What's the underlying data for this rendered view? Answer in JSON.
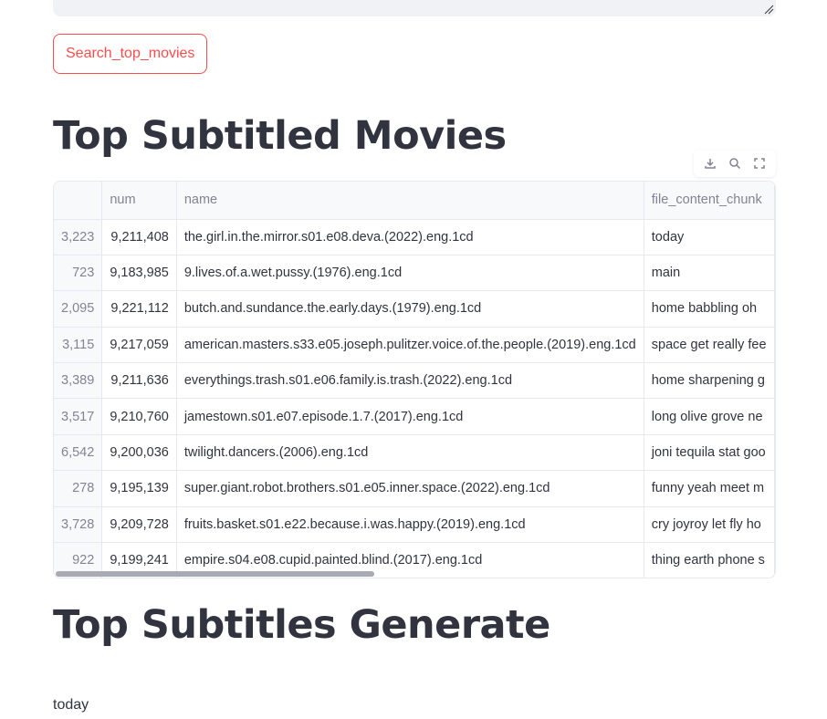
{
  "search_button": {
    "label": "Search_top_movies"
  },
  "sections": {
    "top_movies_title": "Top Subtitled Movies",
    "generate_title": "Top Subtitles Generate",
    "generate_output": "today"
  },
  "toolbar": {
    "icons": [
      "download-icon",
      "search-icon",
      "fullscreen-icon"
    ]
  },
  "table": {
    "columns": [
      "",
      "num",
      "name",
      "file_content_chunk"
    ],
    "rows": [
      {
        "index": "3,223",
        "num": "9,211,408",
        "name": "the.girl.in.the.mirror.s01.e08.deva.(2022).eng.1cd",
        "chunk": "today"
      },
      {
        "index": "723",
        "num": "9,183,985",
        "name": "9.lives.of.a.wet.pussy.(1976).eng.1cd",
        "chunk": "main"
      },
      {
        "index": "2,095",
        "num": "9,221,112",
        "name": "butch.and.sundance.the.early.days.(1979).eng.1cd",
        "chunk": "home babbling oh"
      },
      {
        "index": "3,115",
        "num": "9,217,059",
        "name": "american.masters.s33.e05.joseph.pulitzer.voice.of.the.people.(2019).eng.1cd",
        "chunk": "space get really fee"
      },
      {
        "index": "3,389",
        "num": "9,211,636",
        "name": "everythings.trash.s01.e06.family.is.trash.(2022).eng.1cd",
        "chunk": "home sharpening g"
      },
      {
        "index": "3,517",
        "num": "9,210,760",
        "name": "jamestown.s01.e07.episode.1.7.(2017).eng.1cd",
        "chunk": "long olive grove ne"
      },
      {
        "index": "6,542",
        "num": "9,200,036",
        "name": "twilight.dancers.(2006).eng.1cd",
        "chunk": "joni tequila stat goo"
      },
      {
        "index": "278",
        "num": "9,195,139",
        "name": "super.giant.robot.brothers.s01.e05.inner.space.(2022).eng.1cd",
        "chunk": "funny yeah meet m"
      },
      {
        "index": "3,728",
        "num": "9,209,728",
        "name": "fruits.basket.s01.e22.because.i.was.happy.(2019).eng.1cd",
        "chunk": "cry joyroy let fly ho"
      },
      {
        "index": "922",
        "num": "9,199,241",
        "name": "empire.s04.e08.cupid.painted.blind.(2017).eng.1cd",
        "chunk": "thing earth phone s"
      }
    ]
  },
  "colors": {
    "accent": "#ff4b4b",
    "text": "#31333f",
    "muted": "#808495",
    "border": "#e6e9ef"
  }
}
